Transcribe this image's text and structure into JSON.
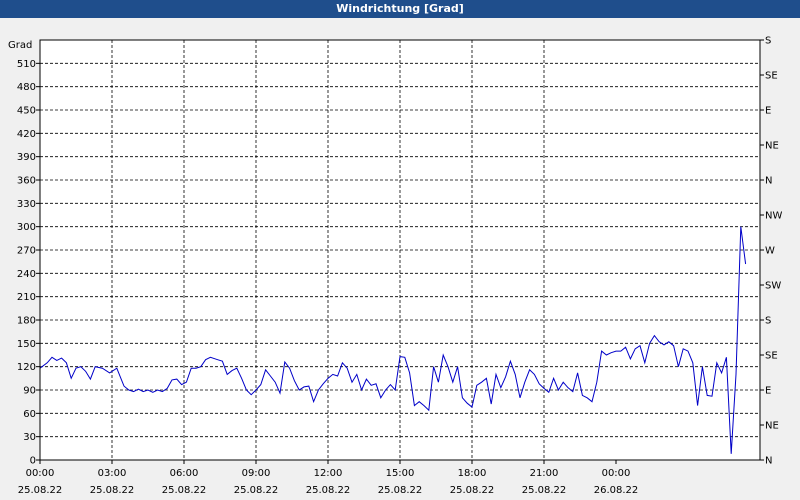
{
  "window": {
    "title": "Windrichtung [Grad]"
  },
  "chart_data": {
    "type": "line",
    "title": "Windrichtung [Grad]",
    "ylabel": "Grad",
    "ylim": [
      0,
      540
    ],
    "yticks": [
      0,
      30,
      60,
      90,
      120,
      150,
      180,
      210,
      240,
      270,
      300,
      330,
      360,
      390,
      420,
      450,
      480,
      510
    ],
    "y2ticks": [
      "N",
      "NE",
      "E",
      "SE",
      "S",
      "SW",
      "W",
      "NW",
      "N",
      "NE",
      "E",
      "SE",
      "S"
    ],
    "xticks": [
      {
        "time": "00:00",
        "date": "25.08.22"
      },
      {
        "time": "03:00",
        "date": "25.08.22"
      },
      {
        "time": "06:00",
        "date": "25.08.22"
      },
      {
        "time": "09:00",
        "date": "25.08.22"
      },
      {
        "time": "12:00",
        "date": "25.08.22"
      },
      {
        "time": "15:00",
        "date": "25.08.22"
      },
      {
        "time": "18:00",
        "date": "25.08.22"
      },
      {
        "time": "21:00",
        "date": "25.08.22"
      },
      {
        "time": "00:00",
        "date": "26.08.22"
      }
    ],
    "grid": true,
    "series": [
      {
        "color": "#0000c8",
        "x_unit": "hours since 25.08.22 00:00",
        "points": [
          [
            0.0,
            118
          ],
          [
            0.3,
            125
          ],
          [
            0.5,
            132
          ],
          [
            0.7,
            128
          ],
          [
            0.9,
            131
          ],
          [
            1.1,
            125
          ],
          [
            1.3,
            105
          ],
          [
            1.5,
            118
          ],
          [
            1.7,
            120
          ],
          [
            1.9,
            114
          ],
          [
            2.1,
            104
          ],
          [
            2.3,
            120
          ],
          [
            2.6,
            118
          ],
          [
            2.9,
            112
          ],
          [
            3.2,
            118
          ],
          [
            3.5,
            95
          ],
          [
            3.7,
            90
          ],
          [
            3.9,
            88
          ],
          [
            4.1,
            91
          ],
          [
            4.3,
            88
          ],
          [
            4.5,
            90
          ],
          [
            4.7,
            87
          ],
          [
            4.9,
            90
          ],
          [
            5.1,
            88
          ],
          [
            5.3,
            92
          ],
          [
            5.5,
            103
          ],
          [
            5.7,
            104
          ],
          [
            5.9,
            97
          ],
          [
            6.1,
            100
          ],
          [
            6.3,
            118
          ],
          [
            6.5,
            118
          ],
          [
            6.7,
            120
          ],
          [
            6.9,
            129
          ],
          [
            7.1,
            132
          ],
          [
            7.4,
            129
          ],
          [
            7.6,
            127
          ],
          [
            7.8,
            110
          ],
          [
            8.0,
            115
          ],
          [
            8.2,
            118
          ],
          [
            8.4,
            105
          ],
          [
            8.6,
            90
          ],
          [
            8.8,
            84
          ],
          [
            9.0,
            90
          ],
          [
            9.2,
            97
          ],
          [
            9.4,
            116
          ],
          [
            9.6,
            108
          ],
          [
            9.8,
            100
          ],
          [
            10.0,
            86
          ],
          [
            10.2,
            126
          ],
          [
            10.4,
            118
          ],
          [
            10.6,
            102
          ],
          [
            10.8,
            90
          ],
          [
            11.0,
            94
          ],
          [
            11.2,
            95
          ],
          [
            11.4,
            75
          ],
          [
            11.6,
            90
          ],
          [
            11.8,
            98
          ],
          [
            12.0,
            105
          ],
          [
            12.2,
            110
          ],
          [
            12.4,
            108
          ],
          [
            12.6,
            125
          ],
          [
            12.8,
            118
          ],
          [
            13.0,
            100
          ],
          [
            13.2,
            110
          ],
          [
            13.4,
            90
          ],
          [
            13.6,
            104
          ],
          [
            13.8,
            96
          ],
          [
            14.0,
            98
          ],
          [
            14.2,
            80
          ],
          [
            14.4,
            90
          ],
          [
            14.6,
            97
          ],
          [
            14.8,
            90
          ],
          [
            15.0,
            133
          ],
          [
            15.2,
            132
          ],
          [
            15.4,
            112
          ],
          [
            15.6,
            70
          ],
          [
            15.8,
            75
          ],
          [
            16.0,
            70
          ],
          [
            16.2,
            64
          ],
          [
            16.4,
            120
          ],
          [
            16.6,
            100
          ],
          [
            16.8,
            135
          ],
          [
            17.0,
            120
          ],
          [
            17.2,
            100
          ],
          [
            17.4,
            120
          ],
          [
            17.6,
            80
          ],
          [
            17.8,
            73
          ],
          [
            18.0,
            68
          ],
          [
            18.2,
            96
          ],
          [
            18.4,
            100
          ],
          [
            18.6,
            105
          ],
          [
            18.8,
            72
          ],
          [
            19.0,
            110
          ],
          [
            19.2,
            93
          ],
          [
            19.4,
            107
          ],
          [
            19.6,
            127
          ],
          [
            19.8,
            110
          ],
          [
            20.0,
            80
          ],
          [
            20.2,
            100
          ],
          [
            20.4,
            116
          ],
          [
            20.6,
            110
          ],
          [
            20.8,
            98
          ],
          [
            21.0,
            92
          ],
          [
            21.2,
            87
          ],
          [
            21.4,
            105
          ],
          [
            21.6,
            90
          ],
          [
            21.8,
            100
          ],
          [
            22.0,
            93
          ],
          [
            22.2,
            88
          ],
          [
            22.4,
            112
          ],
          [
            22.6,
            83
          ],
          [
            22.8,
            80
          ],
          [
            23.0,
            75
          ],
          [
            23.2,
            100
          ],
          [
            23.4,
            140
          ],
          [
            23.6,
            135
          ],
          [
            23.8,
            138
          ],
          [
            24.0,
            140
          ],
          [
            24.2,
            140
          ],
          [
            24.4,
            145
          ],
          [
            24.6,
            130
          ],
          [
            24.8,
            143
          ],
          [
            25.0,
            147
          ],
          [
            25.2,
            125
          ],
          [
            25.4,
            150
          ],
          [
            25.6,
            160
          ],
          [
            25.8,
            152
          ],
          [
            26.0,
            148
          ],
          [
            26.2,
            152
          ],
          [
            26.4,
            147
          ],
          [
            26.6,
            120
          ],
          [
            26.8,
            143
          ],
          [
            27.0,
            140
          ],
          [
            27.2,
            125
          ],
          [
            27.4,
            70
          ],
          [
            27.6,
            120
          ],
          [
            27.8,
            83
          ],
          [
            28.0,
            82
          ],
          [
            28.2,
            125
          ],
          [
            28.4,
            112
          ],
          [
            28.6,
            132
          ],
          [
            28.8,
            8
          ],
          [
            29.0,
            110
          ],
          [
            29.2,
            300
          ],
          [
            29.4,
            252
          ]
        ]
      }
    ]
  }
}
